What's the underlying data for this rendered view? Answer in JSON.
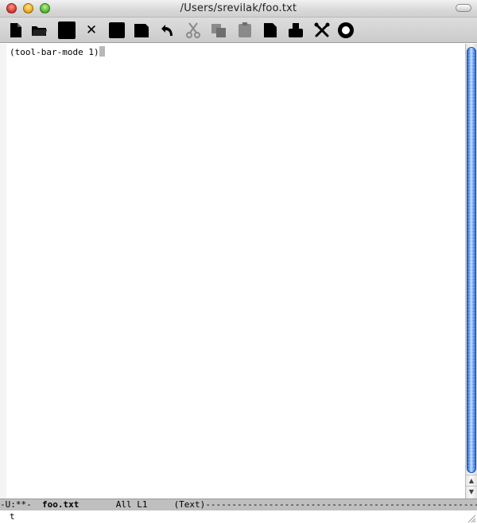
{
  "window": {
    "title": "/Users/srevilak/foo.txt"
  },
  "toolbar": {
    "buttons": [
      {
        "icon": "new-file-icon"
      },
      {
        "icon": "open-folder-icon"
      },
      {
        "icon": "dired-icon"
      },
      {
        "icon": "kill-buffer-icon",
        "glyph": "✕"
      },
      {
        "icon": "save-icon"
      },
      {
        "icon": "save-as-icon"
      },
      {
        "icon": "undo-icon"
      },
      {
        "icon": "cut-icon"
      },
      {
        "icon": "copy-icon"
      },
      {
        "icon": "paste-icon"
      },
      {
        "icon": "search-icon"
      },
      {
        "icon": "print-icon"
      },
      {
        "icon": "preferences-icon"
      },
      {
        "icon": "help-icon"
      }
    ]
  },
  "buffer": {
    "text": "(tool-bar-mode 1)"
  },
  "modeline": {
    "status": "-U:**-  ",
    "buffer_name": "foo.txt",
    "position": "       All L1     ",
    "mode": "(Text)",
    "fill": "-------------------------------------------------------------------------------------"
  },
  "echo": {
    "text": "t"
  },
  "colors": {
    "scroll_thumb": "#4a86e8",
    "modeline_bg": "#bfbfbf",
    "cursor": "#b8b8b8"
  }
}
